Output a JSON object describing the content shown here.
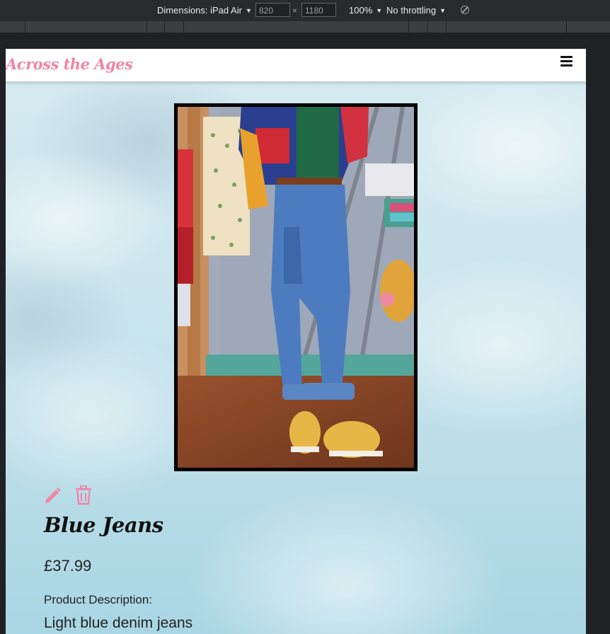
{
  "devtools": {
    "dimensions_label": "Dimensions: iPad Air",
    "width_value": "820",
    "times_symbol": "×",
    "height_value": "1180",
    "zoom": "100%",
    "throttling": "No throttling",
    "icons": [
      "dropdown-caret-icon",
      "rotate-icon"
    ]
  },
  "navbar": {
    "brand": "Across the Ages",
    "menu_icon": "hamburger-menu-icon"
  },
  "product": {
    "image_alt": "Blue Jeans",
    "name": "Blue Jeans",
    "price": "£37.99",
    "description_label": "Product Description:",
    "description": "Light blue denim jeans",
    "actions": {
      "edit_icon": "pencil-icon",
      "delete_icon": "trash-icon"
    }
  },
  "colors": {
    "brand_pink": "#ee86a4",
    "page_sky": "#cde6ee",
    "devtools_bg": "#292a2d"
  }
}
